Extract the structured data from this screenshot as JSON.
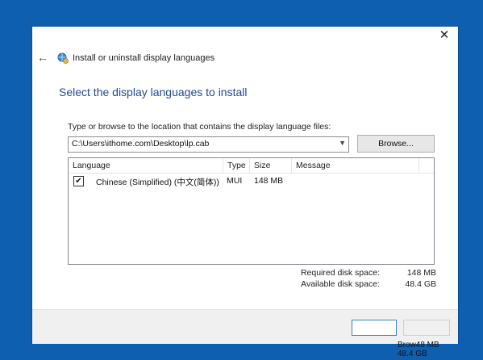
{
  "window": {
    "title": "Install or uninstall display languages",
    "close_glyph": "✕",
    "back_glyph": "←"
  },
  "heading": "Select the display languages to install",
  "path": {
    "label": "Type or browse to the location that contains the display language files:",
    "value": "C:\\Users\\ithome.com\\Desktop\\lp.cab",
    "browse_label": "Browse..."
  },
  "table": {
    "columns": [
      "Language",
      "Type",
      "Size",
      "Message"
    ],
    "rows": [
      {
        "checked": true,
        "language": "Chinese (Simplified) (中文(简体))",
        "type": "MUI",
        "size": "148 MB",
        "message": ""
      }
    ]
  },
  "disk": {
    "required_label": "Required disk space:",
    "required_value": "148 MB",
    "available_label": "Available disk space:",
    "available_value": "48.4 GB"
  },
  "artifact": {
    "line1": "Brow48 MB",
    "line2": "48.4 GB"
  },
  "colors": {
    "desktop": "#0f5fb0",
    "heading": "#1f4a96",
    "focus_border": "#3c7fd0"
  }
}
